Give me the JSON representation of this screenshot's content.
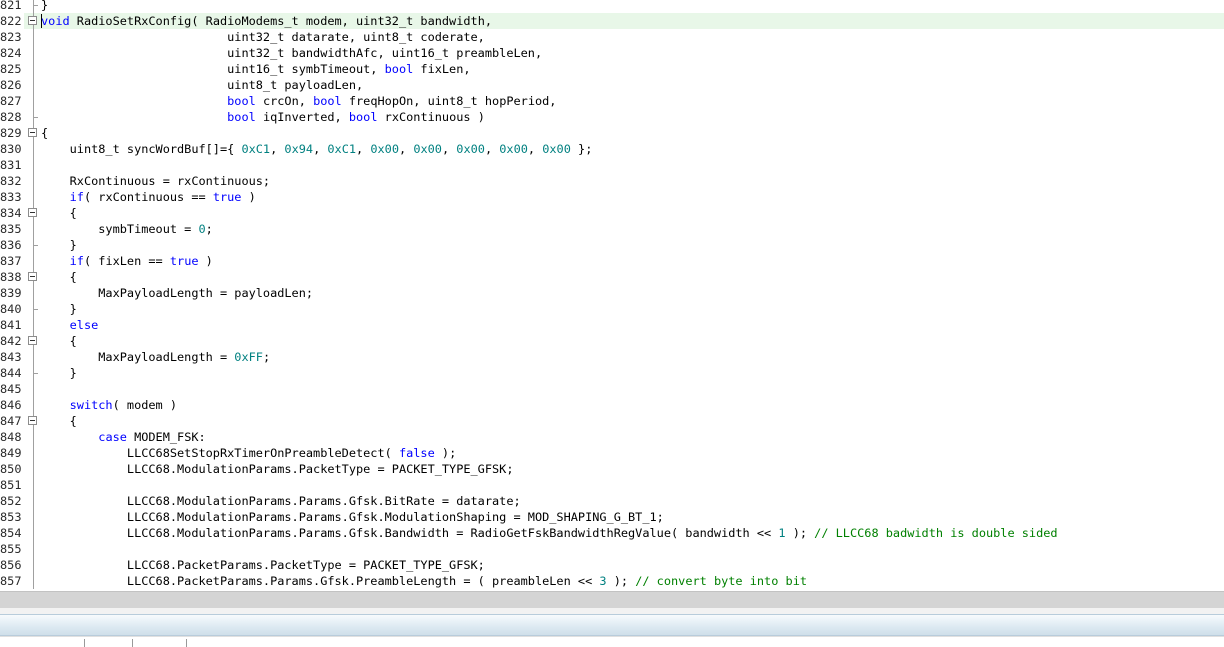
{
  "editor": {
    "top_partial": {
      "number": "821",
      "text": "}"
    },
    "lines": [
      {
        "number": "822",
        "fold": "box",
        "tokens": [
          [
            "kw",
            "void"
          ],
          [
            "t",
            " RadioSetRxConfig( RadioModems_t modem, uint32_t bandwidth,"
          ]
        ]
      },
      {
        "number": "823",
        "fold": "line",
        "tokens": [
          [
            "t",
            "                          uint32_t datarate, uint8_t coderate,"
          ]
        ]
      },
      {
        "number": "824",
        "fold": "line",
        "tokens": [
          [
            "t",
            "                          uint32_t bandwidthAfc, uint16_t preambleLen,"
          ]
        ]
      },
      {
        "number": "825",
        "fold": "line",
        "tokens": [
          [
            "t",
            "                          uint16_t symbTimeout, "
          ],
          [
            "kw",
            "bool"
          ],
          [
            "t",
            " fixLen,"
          ]
        ]
      },
      {
        "number": "826",
        "fold": "line",
        "tokens": [
          [
            "t",
            "                          uint8_t payloadLen,"
          ]
        ]
      },
      {
        "number": "827",
        "fold": "line",
        "tokens": [
          [
            "t",
            "                          "
          ],
          [
            "kw",
            "bool"
          ],
          [
            "t",
            " crcOn, "
          ],
          [
            "kw",
            "bool"
          ],
          [
            "t",
            " freqHopOn, uint8_t hopPeriod,"
          ]
        ]
      },
      {
        "number": "828",
        "fold": "end",
        "tokens": [
          [
            "t",
            "                          "
          ],
          [
            "kw",
            "bool"
          ],
          [
            "t",
            " iqInverted, "
          ],
          [
            "kw",
            "bool"
          ],
          [
            "t",
            " rxContinuous )"
          ]
        ]
      },
      {
        "number": "829",
        "fold": "box",
        "tokens": [
          [
            "t",
            "{"
          ]
        ]
      },
      {
        "number": "830",
        "fold": "line",
        "tokens": [
          [
            "t",
            "    uint8_t syncWordBuf[]={ "
          ],
          [
            "num",
            "0xC1"
          ],
          [
            "t",
            ", "
          ],
          [
            "num",
            "0x94"
          ],
          [
            "t",
            ", "
          ],
          [
            "num",
            "0xC1"
          ],
          [
            "t",
            ", "
          ],
          [
            "num",
            "0x00"
          ],
          [
            "t",
            ", "
          ],
          [
            "num",
            "0x00"
          ],
          [
            "t",
            ", "
          ],
          [
            "num",
            "0x00"
          ],
          [
            "t",
            ", "
          ],
          [
            "num",
            "0x00"
          ],
          [
            "t",
            ", "
          ],
          [
            "num",
            "0x00"
          ],
          [
            "t",
            " };"
          ]
        ]
      },
      {
        "number": "831",
        "fold": "line",
        "tokens": [
          [
            "t",
            ""
          ]
        ]
      },
      {
        "number": "832",
        "fold": "line",
        "tokens": [
          [
            "t",
            "    RxContinuous = rxContinuous;"
          ]
        ]
      },
      {
        "number": "833",
        "fold": "line",
        "tokens": [
          [
            "t",
            "    "
          ],
          [
            "kw",
            "if"
          ],
          [
            "t",
            "( rxContinuous == "
          ],
          [
            "kw",
            "true"
          ],
          [
            "t",
            " )"
          ]
        ]
      },
      {
        "number": "834",
        "fold": "box",
        "tokens": [
          [
            "t",
            "    {"
          ]
        ]
      },
      {
        "number": "835",
        "fold": "line",
        "tokens": [
          [
            "t",
            "        symbTimeout = "
          ],
          [
            "num",
            "0"
          ],
          [
            "t",
            ";"
          ]
        ]
      },
      {
        "number": "836",
        "fold": "end",
        "tokens": [
          [
            "t",
            "    }"
          ]
        ]
      },
      {
        "number": "837",
        "fold": "line",
        "tokens": [
          [
            "t",
            "    "
          ],
          [
            "kw",
            "if"
          ],
          [
            "t",
            "( fixLen == "
          ],
          [
            "kw",
            "true"
          ],
          [
            "t",
            " )"
          ]
        ]
      },
      {
        "number": "838",
        "fold": "box",
        "tokens": [
          [
            "t",
            "    {"
          ]
        ]
      },
      {
        "number": "839",
        "fold": "line",
        "tokens": [
          [
            "t",
            "        MaxPayloadLength = payloadLen;"
          ]
        ]
      },
      {
        "number": "840",
        "fold": "end",
        "tokens": [
          [
            "t",
            "    }"
          ]
        ]
      },
      {
        "number": "841",
        "fold": "line",
        "tokens": [
          [
            "t",
            "    "
          ],
          [
            "kw",
            "else"
          ]
        ]
      },
      {
        "number": "842",
        "fold": "box",
        "tokens": [
          [
            "t",
            "    {"
          ]
        ]
      },
      {
        "number": "843",
        "fold": "line",
        "tokens": [
          [
            "t",
            "        MaxPayloadLength = "
          ],
          [
            "num",
            "0xFF"
          ],
          [
            "t",
            ";"
          ]
        ]
      },
      {
        "number": "844",
        "fold": "end",
        "tokens": [
          [
            "t",
            "    }"
          ]
        ]
      },
      {
        "number": "845",
        "fold": "line",
        "tokens": [
          [
            "t",
            ""
          ]
        ]
      },
      {
        "number": "846",
        "fold": "line",
        "tokens": [
          [
            "t",
            "    "
          ],
          [
            "kw",
            "switch"
          ],
          [
            "t",
            "( modem )"
          ]
        ]
      },
      {
        "number": "847",
        "fold": "box",
        "tokens": [
          [
            "t",
            "    {"
          ]
        ]
      },
      {
        "number": "848",
        "fold": "line",
        "tokens": [
          [
            "t",
            "        "
          ],
          [
            "kw",
            "case"
          ],
          [
            "t",
            " MODEM_FSK:"
          ]
        ]
      },
      {
        "number": "849",
        "fold": "line",
        "tokens": [
          [
            "t",
            "            LLCC68SetStopRxTimerOnPreambleDetect( "
          ],
          [
            "kw",
            "false"
          ],
          [
            "t",
            " );"
          ]
        ]
      },
      {
        "number": "850",
        "fold": "line",
        "tokens": [
          [
            "t",
            "            LLCC68.ModulationParams.PacketType = PACKET_TYPE_GFSK;"
          ]
        ]
      },
      {
        "number": "851",
        "fold": "line",
        "tokens": [
          [
            "t",
            ""
          ]
        ]
      },
      {
        "number": "852",
        "fold": "line",
        "tokens": [
          [
            "t",
            "            LLCC68.ModulationParams.Params.Gfsk.BitRate = datarate;"
          ]
        ]
      },
      {
        "number": "853",
        "fold": "line",
        "tokens": [
          [
            "t",
            "            LLCC68.ModulationParams.Params.Gfsk.ModulationShaping = MOD_SHAPING_G_BT_1;"
          ]
        ]
      },
      {
        "number": "854",
        "fold": "line",
        "tokens": [
          [
            "t",
            "            LLCC68.ModulationParams.Params.Gfsk.Bandwidth = RadioGetFskBandwidthRegValue( bandwidth << "
          ],
          [
            "num",
            "1"
          ],
          [
            "t",
            " ); "
          ],
          [
            "cm",
            "// LLCC68 badwidth is double sided"
          ]
        ]
      },
      {
        "number": "855",
        "fold": "line",
        "tokens": [
          [
            "t",
            ""
          ]
        ]
      },
      {
        "number": "856",
        "fold": "line",
        "tokens": [
          [
            "t",
            "            LLCC68.PacketParams.PacketType = PACKET_TYPE_GFSK;"
          ]
        ]
      },
      {
        "number": "857",
        "fold": "line",
        "tokens": [
          [
            "t",
            "            LLCC68.PacketParams.Params.Gfsk.PreambleLength = ( preambleLen << "
          ],
          [
            "num",
            "3"
          ],
          [
            "t",
            " ); "
          ],
          [
            "cm",
            "// convert byte into bit"
          ]
        ]
      }
    ]
  }
}
